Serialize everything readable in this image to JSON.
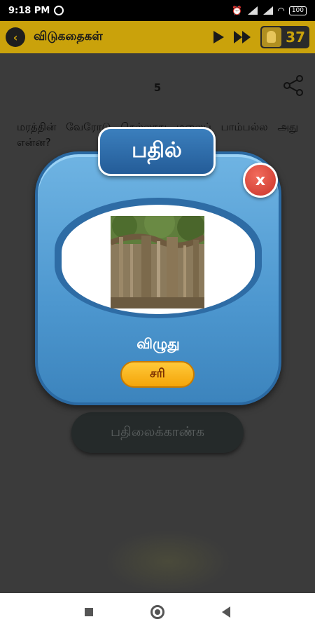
{
  "status_bar": {
    "time": "9:18 PM",
    "battery": "100"
  },
  "app_bar": {
    "title": "விடுகதைகள்",
    "coins": "37"
  },
  "content": {
    "question_number": "5",
    "riddle_text": "மரத்தின் வேரோடு செல்லாது மலைப் பாம்பல்ல அது என்ன?",
    "show_answer_label": "பதிலைக்காண்க"
  },
  "dialog": {
    "title": "பதில்",
    "close_label": "x",
    "answer": "விழுது",
    "ok_label": "சரி"
  },
  "icons": {
    "back": "back-arrow-icon",
    "play": "play-icon",
    "fast_forward": "fast-forward-icon",
    "coin": "coin-icon",
    "share": "share-icon"
  },
  "colors": {
    "app_bar": "#caa20b",
    "dialog_blue": "#4d97cf",
    "ok_button": "#f4a509",
    "close_button": "#e04a3c"
  }
}
